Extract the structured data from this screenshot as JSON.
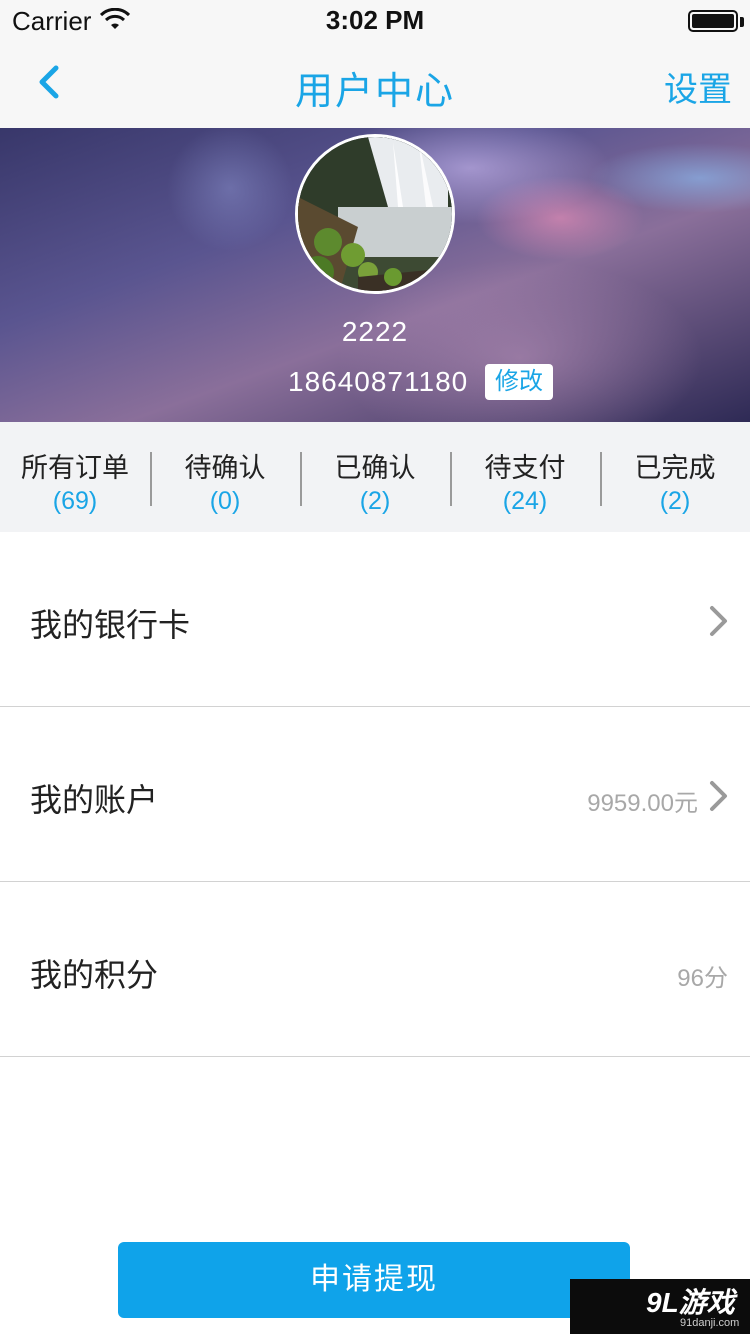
{
  "status_bar": {
    "carrier": "Carrier",
    "time": "3:02 PM"
  },
  "nav": {
    "title": "用户中心",
    "settings_label": "设置"
  },
  "profile": {
    "username": "2222",
    "phone": "18640871180",
    "edit_label": "修改"
  },
  "order_stats": [
    {
      "label": "所有订单",
      "count": "(69)"
    },
    {
      "label": "待确认",
      "count": "(0)"
    },
    {
      "label": "已确认",
      "count": "(2)"
    },
    {
      "label": "待支付",
      "count": "(24)"
    },
    {
      "label": "已完成",
      "count": "(2)"
    }
  ],
  "menu": {
    "bank_card": {
      "label": "我的银行卡"
    },
    "account": {
      "label": "我的账户",
      "value": "9959.00元"
    },
    "points": {
      "label": "我的积分",
      "value": "96分"
    }
  },
  "withdraw_button": "申请提现",
  "watermark": {
    "logo": "9L游戏",
    "url": "91danji.com"
  },
  "colors": {
    "accent": "#1aa5e6",
    "button": "#0fa3ea",
    "stats_bg": "#f2f3f5"
  }
}
